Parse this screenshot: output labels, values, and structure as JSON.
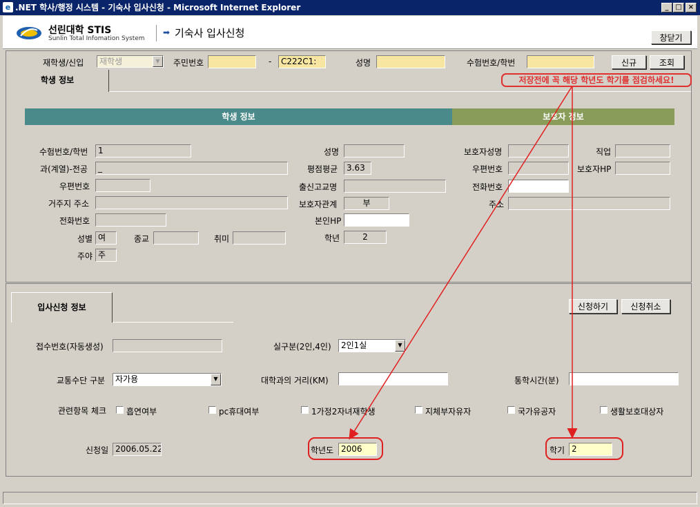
{
  "window": {
    "title": ".NET 학사/행정 시스템 - 기숙사 입사신청 - Microsoft Internet Explorer",
    "minimize": "_",
    "maximize": "□",
    "close": "×"
  },
  "header": {
    "university": "선린대학 STIS",
    "subtitle": "Sunlin Total Infomation System",
    "page_title": "기숙사 입사신청",
    "close_window": "창닫기"
  },
  "search": {
    "status_label": "재학생/신입",
    "status_value": "재학생",
    "rrn_label": "주민번호",
    "rrn_dash": "-",
    "rrn_back": "C222C1:",
    "name_label": "성명",
    "name_value": "",
    "exam_label": "수험번호/학번",
    "exam_value": "",
    "new_button": "신규",
    "search_button": "조회"
  },
  "tabs": {
    "student_info": "학생 정보",
    "apply_info": "입사신청 정보"
  },
  "warning": "저장전에 꼭 해당 학년도 학기를 점검하세요!",
  "bars": {
    "student": "학생 정보",
    "guardian": "보호자 정보"
  },
  "student": {
    "exam_no_label": "수험번호/학번",
    "exam_no_value": "1",
    "dept_label": "과(계열)-전공",
    "dept_value": "_",
    "zip_label": "우편번호",
    "zip_value": "",
    "address_label": "거주지 주소",
    "address_value": "",
    "phone_label": "전화번호",
    "phone_value": "",
    "gender_label": "성별",
    "gender_value": "여",
    "religion_label": "종교",
    "religion_value": "",
    "hobby_label": "취미",
    "hobby_value": "",
    "daynight_label": "주야",
    "daynight_value": "주",
    "name_label": "성명",
    "name_value": "",
    "gpa_label": "평점평균",
    "gpa_value": "3.63",
    "school_label": "출신고교명",
    "school_value": "",
    "relation_label": "보호자관계",
    "relation_value": "부",
    "mobile_label": "본인HP",
    "mobile_value": "",
    "grade_label": "학년",
    "grade_value": "2"
  },
  "guardian": {
    "name_label": "보호자성명",
    "name_value": "",
    "job_label": "직업",
    "job_value": "",
    "zip_label": "우편번호",
    "zip_value": "",
    "hp_label": "보호자HP",
    "hp_value": "",
    "phone_label": "전화번호",
    "phone_value": "",
    "address_label": "주소",
    "address_value": ""
  },
  "apply": {
    "apply_button": "신청하기",
    "cancel_button": "신청취소",
    "receipt_label": "접수번호(자동생성)",
    "receipt_value": "",
    "room_label": "실구분(2인,4인)",
    "room_value": "2인1실",
    "transport_label": "교통수단 구분",
    "transport_value": "자가용",
    "distance_label": "대학과의 거리(KM)",
    "distance_value": "",
    "commute_label": "통학시간(분)",
    "commute_value": "",
    "check_label": "관련항목 체크",
    "checks": [
      "흡연여부",
      "pc휴대여부",
      "1가정2자녀재학생",
      "지체부자유자",
      "국가유공자",
      "생활보호대상자"
    ],
    "date_label": "신청일",
    "date_value": "2006.05.22",
    "year_label": "학년도",
    "year_value": "2006",
    "semester_label": "학기",
    "semester_value": "2"
  },
  "colors": {
    "titlebar": "#0a246a",
    "student_bar": "#4a8a8a",
    "guardian_bar": "#8a9c5a",
    "annotation": "#e02020"
  }
}
